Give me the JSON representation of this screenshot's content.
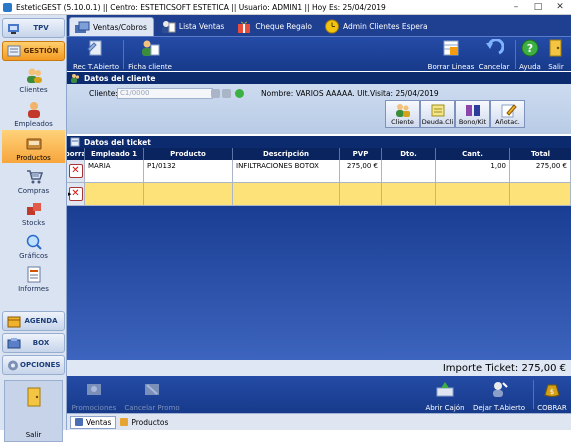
{
  "window": {
    "title": "EsteticGEST (5.10.0.1) || Centro: ESTETICSOFT ESTETICA  || Usuario: ADMIN1 || Hoy Es: 25/04/2019"
  },
  "sidebar": {
    "sections": [
      {
        "label": "TPV"
      },
      {
        "label": "GESTIÓN"
      },
      {
        "label": "AGENDA"
      },
      {
        "label": "BOX"
      },
      {
        "label": "OPCIONES"
      }
    ],
    "items": [
      {
        "label": "Clientes"
      },
      {
        "label": "Empleados"
      },
      {
        "label": "Productos"
      },
      {
        "label": "Compras"
      },
      {
        "label": "Stocks"
      },
      {
        "label": "Gráficos"
      },
      {
        "label": "Informes"
      }
    ],
    "salir_label": "Salir"
  },
  "tabs": [
    {
      "label": "Ventas/Cobros"
    },
    {
      "label": "Lista Ventas"
    },
    {
      "label": "Cheque Regalo"
    },
    {
      "label": "Admin Clientes Espera"
    }
  ],
  "toolbar": {
    "rec_label": "Rec T.Abierto",
    "ficha_label": "Ficha cliente",
    "borrar_label": "Borrar Lineas",
    "cancelar_label": "Cancelar",
    "ayuda_label": "Ayuda",
    "salir_label": "Salir"
  },
  "client_section": {
    "header": "Datos del cliente",
    "cliente_label": "Cliente:",
    "cliente_value": "C1/0000",
    "nombre_text": "Nombre: VARIOS AAAAA. Ult.Visita: 25/04/2019",
    "buttons": [
      {
        "label": "Cliente"
      },
      {
        "label": "Deuda.Cli"
      },
      {
        "label": "Bono/Kit"
      },
      {
        "label": "Añotac."
      }
    ]
  },
  "ticket": {
    "header": "Datos del ticket",
    "columns": [
      "borra",
      "Empleado 1",
      "Producto",
      "Descripción",
      "PVP",
      "Dto.",
      "Cant.",
      "Total"
    ],
    "rows": [
      {
        "empleado": "MARIA",
        "producto": "P1/0132",
        "descripcion": "INFILTRACIONES BOTOX",
        "pvp": "275,00 €",
        "dto": "",
        "cant": "1,00",
        "total": "275,00 €"
      },
      {
        "empleado": "",
        "producto": "",
        "descripcion": "",
        "pvp": "",
        "dto": "",
        "cant": "",
        "total": ""
      }
    ],
    "importe_text": "Importe Ticket: 275,00 €"
  },
  "bottom": {
    "promociones_label": "Promociones",
    "cancelar_promo_label": "Cancelar Promo",
    "abrir_cajon_label": "Abrir Cajón",
    "dejar_label": "Dejar T.Abierto",
    "cobrar_label": "COBRAR"
  },
  "status_tabs": [
    {
      "label": "Ventas"
    },
    {
      "label": "Productos"
    }
  ]
}
